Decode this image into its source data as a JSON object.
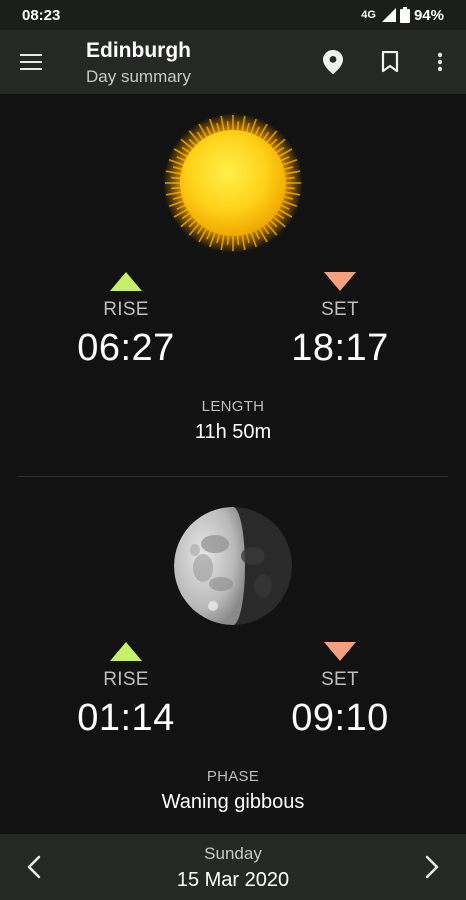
{
  "status": {
    "time": "08:23",
    "network": "4G",
    "battery": "94%"
  },
  "app_bar": {
    "title": "Edinburgh",
    "subtitle": "Day summary",
    "icons": [
      "menu-icon",
      "location-pin-icon",
      "bookmark-icon",
      "more-vert-icon"
    ]
  },
  "sun": {
    "rise_label": "RISE",
    "rise_time": "06:27",
    "set_label": "SET",
    "set_time": "18:17",
    "length_label": "LENGTH",
    "length_value": "11h 50m"
  },
  "moon": {
    "rise_label": "RISE",
    "rise_time": "01:14",
    "set_label": "SET",
    "set_time": "09:10",
    "phase_label": "PHASE",
    "phase_value": "Waning gibbous"
  },
  "bottom": {
    "day": "Sunday",
    "date": "15 Mar 2020"
  },
  "colors": {
    "rise": "#c6f06a",
    "set": "#f4a07f",
    "background": "#111211",
    "bar": "#262826"
  }
}
